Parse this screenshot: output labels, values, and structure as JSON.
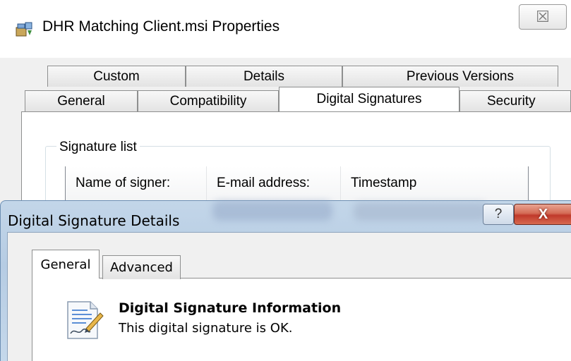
{
  "properties_window": {
    "title": "DHR Matching Client.msi Properties",
    "close_glyph": "☒",
    "tabs_row1": [
      "Custom",
      "Details",
      "Previous Versions"
    ],
    "tabs_row2": [
      "General",
      "Compatibility",
      "Digital Signatures",
      "Security"
    ],
    "active_tab": "Digital Signatures",
    "signature_list": {
      "legend": "Signature list",
      "columns": [
        "Name of signer:",
        "E-mail address:",
        "Timestamp"
      ]
    }
  },
  "details_window": {
    "title": "Digital Signature Details",
    "help_glyph": "?",
    "close_glyph": "X",
    "tabs": [
      "General",
      "Advanced"
    ],
    "active_tab": "General",
    "info_heading": "Digital Signature Information",
    "info_status": "This digital signature is OK."
  },
  "colors": {
    "titlebar_glass": "#b6cce3",
    "close_button_red": "#c0392b",
    "panel_white": "#ffffff",
    "dialog_gray": "#f0f0f0"
  },
  "icons": [
    "installer-package-icon",
    "close-icon",
    "help-icon",
    "signature-document-icon"
  ]
}
